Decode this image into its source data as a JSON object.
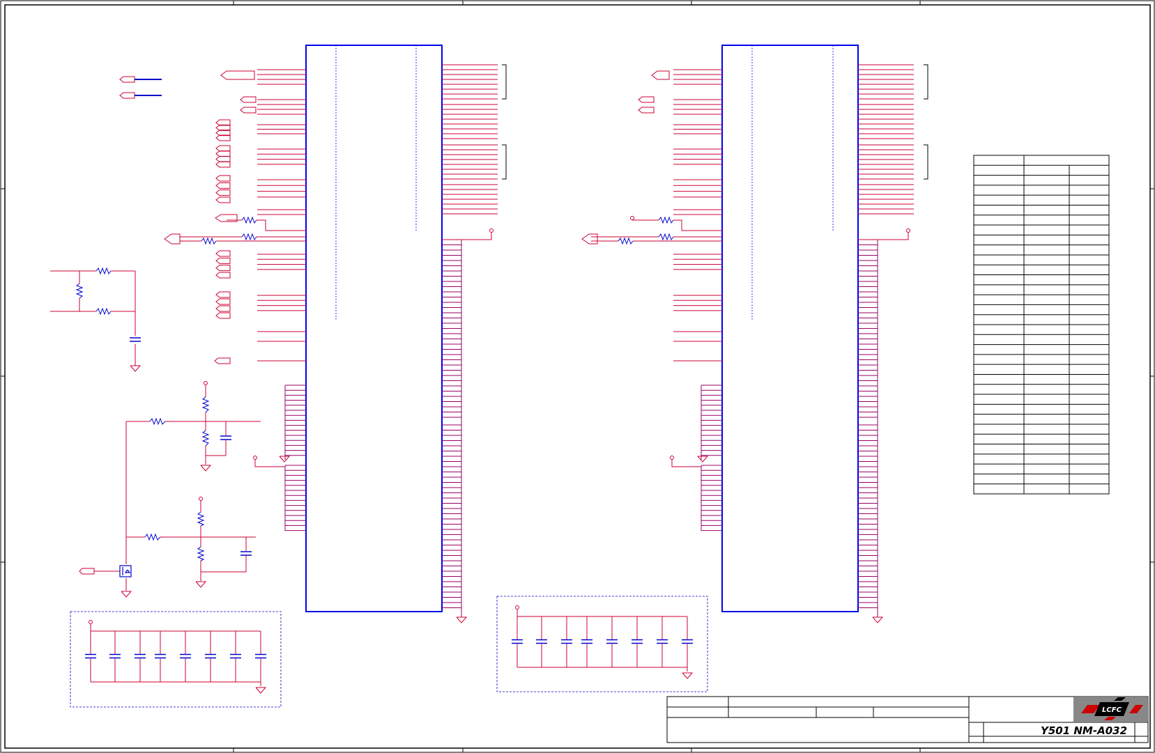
{
  "title_block": {
    "model": "Y501  NM-A032",
    "logo": "LCFC"
  },
  "colors": {
    "wire": "#cc0033",
    "bus": "#990066",
    "ic_body": "#0000ee",
    "component": "#0000cc",
    "border": "#000000",
    "title_gray": "#888888"
  },
  "icons": {
    "ground": "ground-icon",
    "power": "power-icon",
    "port": "port-icon",
    "resistor": "resistor-icon",
    "capacitor": "capacitor-icon",
    "mosfet": "mosfet-icon"
  },
  "pin_table": {
    "rows": 34,
    "cols": 3
  }
}
